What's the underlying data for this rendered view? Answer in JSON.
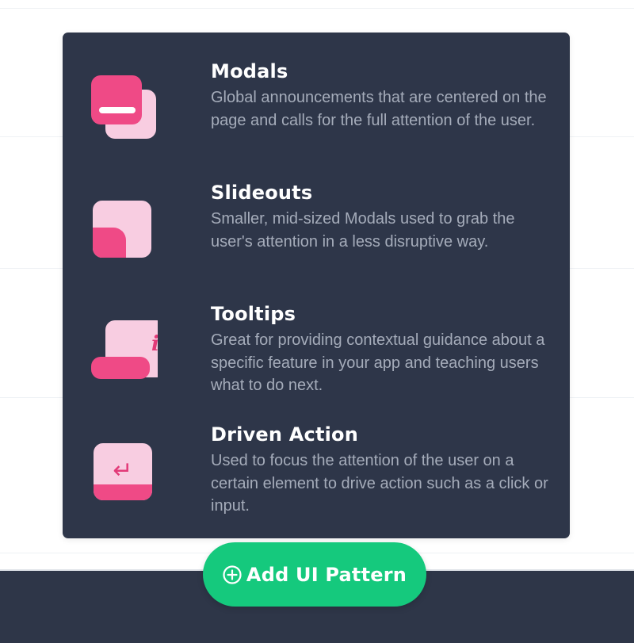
{
  "panel": {
    "items": [
      {
        "title": "Modals",
        "description": "Global announcements that are centered on the page and calls for the full attention of the user.",
        "icon": "modal-icon"
      },
      {
        "title": "Slideouts",
        "description": "Smaller, mid-sized Modals used to grab the user's attention in a less disruptive way.",
        "icon": "slideout-icon"
      },
      {
        "title": "Tooltips",
        "description": "Great for providing contextual guidance about a specific feature in your app and teaching users what to do next.",
        "icon": "tooltip-icon"
      },
      {
        "title": "Driven Action",
        "description": "Used to focus the attention of the user on a certain element to drive action such as a click or input.",
        "icon": "driven-action-icon"
      }
    ]
  },
  "add_button": {
    "label": "Add UI Pattern",
    "icon": "plus-circle-icon"
  },
  "colors": {
    "panel_bg": "#2e3649",
    "accent_pink": "#ef4a86",
    "light_pink": "#f8cde1",
    "button_green": "#15c97d",
    "title_white": "#ffffff",
    "description_gray": "#a5acba"
  },
  "tooltip_glyph": "i",
  "enter_glyph": "↵"
}
